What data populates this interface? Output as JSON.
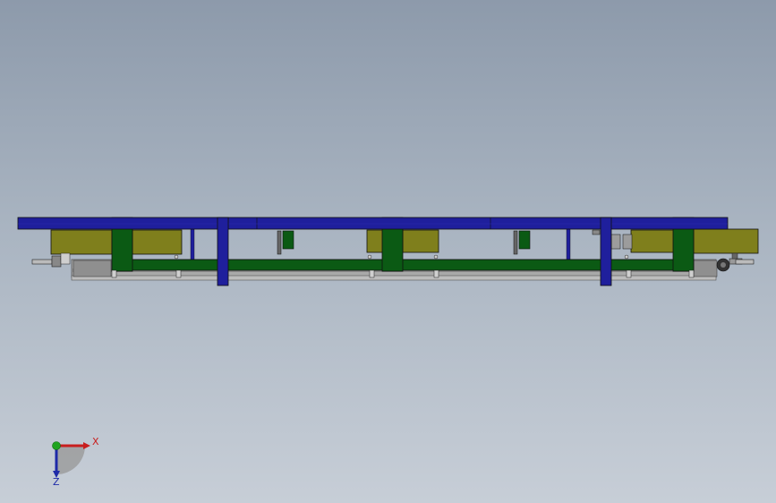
{
  "viewport": {
    "background_top": "#8d9aab",
    "background_bottom": "#c7ced7"
  },
  "model": {
    "colors": {
      "top_rail": "#1f1f9c",
      "frame": "#0b5a14",
      "tray": "#7a7a1a",
      "rail": "#a9a9a9",
      "outline": "#111111"
    }
  },
  "triad": {
    "x_label": "X",
    "z_label": "Z",
    "x_color": "#c81e1e",
    "z_color": "#1e2aa8",
    "y_color": "#1ea31e"
  }
}
